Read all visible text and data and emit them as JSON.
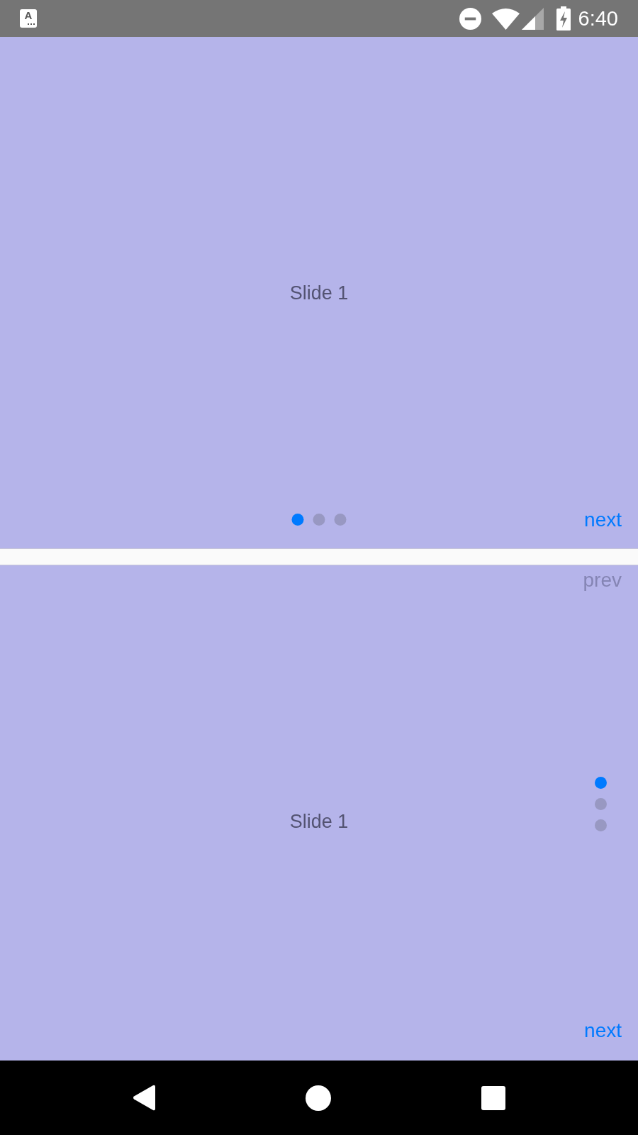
{
  "status_bar": {
    "notification_glyph": "A",
    "time": "6:40"
  },
  "carousels": [
    {
      "kind": "horizontal",
      "slide": "Slide 1",
      "dots": [
        {
          "selected": true
        },
        {
          "selected": false
        },
        {
          "selected": false
        }
      ],
      "next": {
        "label": "next",
        "disabled": false
      }
    },
    {
      "kind": "vertical",
      "slide": "Slide 1",
      "dots": [
        {
          "selected": true
        },
        {
          "selected": false
        },
        {
          "selected": false
        }
      ],
      "prev": {
        "label": "prev",
        "disabled": true
      },
      "next": {
        "label": "next",
        "disabled": false
      }
    }
  ]
}
